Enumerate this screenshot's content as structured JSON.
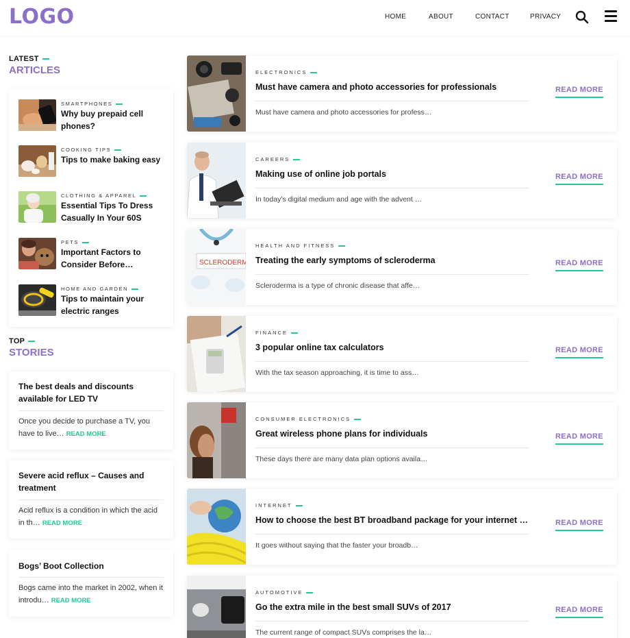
{
  "header": {
    "logo": "LOGO",
    "nav": [
      {
        "label": "HOME"
      },
      {
        "label": "ABOUT"
      },
      {
        "label": "CONTACT"
      },
      {
        "label": "PRIVACY"
      }
    ],
    "search_icon": "search-icon",
    "menu_icon": "hamburger-menu-icon"
  },
  "colors": {
    "accent_purple": "#8c6fc8",
    "accent_green": "#20c997"
  },
  "latest": {
    "label_small": "LATEST",
    "label_big": "ARTICLES",
    "items": [
      {
        "category": "SMARTPHONES",
        "title": "Why buy prepaid cell phones?"
      },
      {
        "category": "COOKING TIPS",
        "title": "Tips to make baking easy"
      },
      {
        "category": "CLOTHING & APPAREL",
        "title": "Essential Tips To Dress Casually In Your 60S"
      },
      {
        "category": "PETS",
        "title": "Important Factors to Consider Before Adoptin…"
      },
      {
        "category": "HOME AND GARDEN",
        "title": "Tips to maintain your electric ranges"
      }
    ]
  },
  "top": {
    "label_small": "TOP",
    "label_big": "STORIES",
    "items": [
      {
        "title": "The best deals and discounts available for LED TV",
        "excerpt": "Once you decide to purchase a TV, you have to live… ",
        "read_more": "READ MORE"
      },
      {
        "title": "Severe acid reflux – Causes and treatment",
        "excerpt": "Acid reflux is a condition in which the acid in th… ",
        "read_more": "READ MORE"
      },
      {
        "title": "Bogs’ Boot Collection",
        "excerpt": "Bogs came into the market in 2002, when it introdu… ",
        "read_more": "READ MORE"
      }
    ]
  },
  "articles": [
    {
      "category": "ELECTRONICS",
      "title": "Must have camera and photo accessories for professionals",
      "excerpt": "Must have camera and photo accessories for profess…",
      "read_more": "READ MORE"
    },
    {
      "category": "CAREERS",
      "title": "Making use of online job portals",
      "excerpt": "In today’s digital medium and age with the advent …",
      "read_more": "READ MORE"
    },
    {
      "category": "HEALTH AND FITNESS",
      "title": "Treating the early symptoms of scleroderma",
      "excerpt": "Scleroderma is a type of chronic disease that affe…",
      "read_more": "READ MORE",
      "image_text": "SCLERODERMA"
    },
    {
      "category": "FINANCE",
      "title": "3 popular online tax calculators",
      "excerpt": "With the tax season approaching, it is time to ass…",
      "read_more": "READ MORE"
    },
    {
      "category": "CONSUMER ELECTRONICS",
      "title": "Great wireless phone plans for individuals",
      "excerpt": "These days there are many data plan options availa…",
      "read_more": "READ MORE"
    },
    {
      "category": "INTERNET",
      "title": "How to choose the best BT broadband package for your internet …",
      "excerpt": "It goes without saying that the faster your broadb…",
      "read_more": "READ MORE"
    },
    {
      "category": "AUTOMOTIVE",
      "title": "Go the extra mile in the best small SUVs of 2017",
      "excerpt": "The current range of compact SUVs comprises the la…",
      "read_more": "READ MORE"
    }
  ]
}
